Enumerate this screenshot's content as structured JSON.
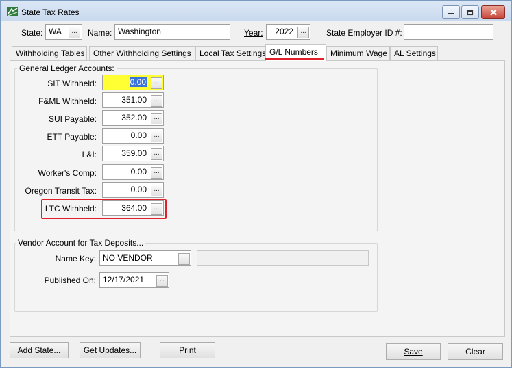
{
  "window": {
    "title": "State Tax Rates",
    "buttons": {
      "minimize": "minimize-icon",
      "maximize": "maximize-icon",
      "close": "close-icon"
    }
  },
  "header": {
    "state_label": "State:",
    "state_value": "WA",
    "name_label": "Name:",
    "name_value": "Washington",
    "year_label": "Year:",
    "year_value": "2022",
    "employer_id_label": "State Employer ID #:",
    "employer_id_value": "",
    "browse_label": "..."
  },
  "tabs": [
    {
      "label": "Withholding Tables"
    },
    {
      "label": "Other Withholding Settings"
    },
    {
      "label": "Local Tax Settings"
    },
    {
      "label": "G/L Numbers",
      "active": true
    },
    {
      "label": "Minimum Wage"
    },
    {
      "label": "AL Settings"
    }
  ],
  "gl_accounts": {
    "title": "General Ledger Accounts:",
    "rows": [
      {
        "label": "SIT Withheld:",
        "value": "0.00",
        "selected": true
      },
      {
        "label": "F&ML Withheld:",
        "value": "351.00"
      },
      {
        "label": "SUI Payable:",
        "value": "352.00"
      },
      {
        "label": "ETT Payable:",
        "value": "0.00"
      },
      {
        "label": "L&I:",
        "value": "359.00"
      },
      {
        "label": "Worker's Comp:",
        "value": "0.00"
      },
      {
        "label": "Oregon Transit Tax:",
        "value": "0.00"
      },
      {
        "label": "LTC Withheld:",
        "value": "364.00",
        "highlighted": true
      }
    ]
  },
  "vendor": {
    "title": "Vendor Account for Tax Deposits...",
    "name_key_label": "Name Key:",
    "name_key_value": "NO VENDOR",
    "vendor_description": "",
    "published_on_label": "Published On:",
    "published_on_value": "12/17/2021"
  },
  "footer": {
    "add_state": "Add State...",
    "get_updates": "Get Updates...",
    "print": "Print",
    "save": "Save",
    "clear": "Clear"
  },
  "colors": {
    "highlight": "#e0202a",
    "selected_field": "#ffff33",
    "selection": "#3a74d8"
  }
}
